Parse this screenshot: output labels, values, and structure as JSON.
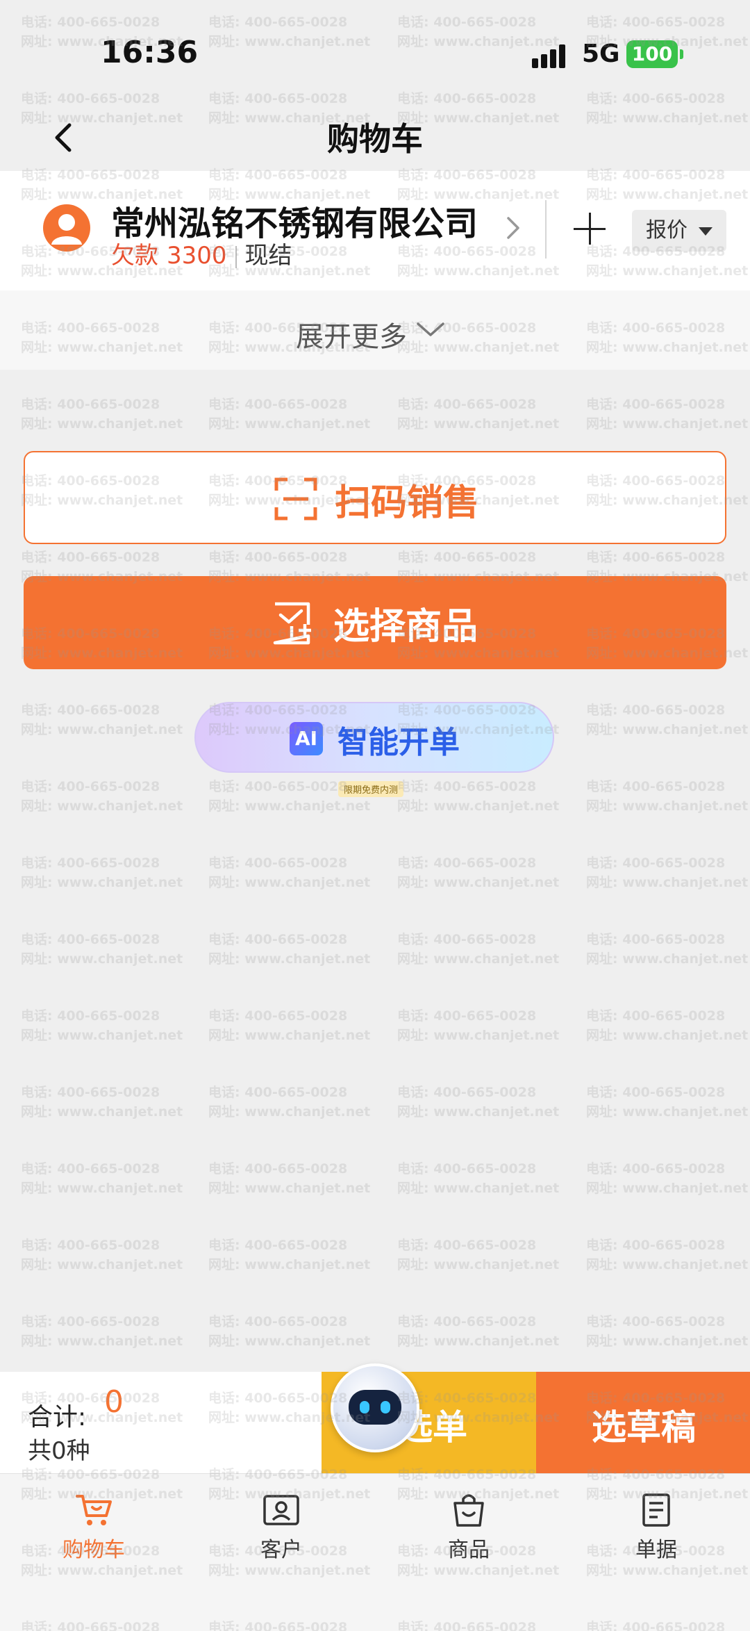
{
  "status_bar": {
    "time": "16:36",
    "network": "5G",
    "battery": "100"
  },
  "nav": {
    "title": "购物车"
  },
  "customer": {
    "name": "常州泓铭不锈钢有限公司",
    "debt_label": "欠款",
    "debt_value": "3300",
    "settle_label": "现结",
    "quote_label": "报价"
  },
  "expand": {
    "label": "展开更多"
  },
  "actions": {
    "scan_label": "扫码销售",
    "select_label": "选择商品",
    "ai_badge": "AI",
    "ai_label": "智能开单",
    "ai_tag": "限期免费内测"
  },
  "summary": {
    "total_label": "合计:",
    "total_value": "0",
    "kind_count": "共0种",
    "order_label": "选单",
    "draft_label": "选草稿"
  },
  "tabs": [
    {
      "label": "购物车",
      "icon": "cart-icon",
      "active": true
    },
    {
      "label": "客户",
      "icon": "customer-card-icon",
      "active": false
    },
    {
      "label": "商品",
      "icon": "shopping-bag-icon",
      "active": false
    },
    {
      "label": "单据",
      "icon": "document-icon",
      "active": false
    }
  ],
  "watermark": {
    "phone": "电话: 400-665-0028",
    "site": "网址: www.chanjet.net"
  },
  "colors": {
    "accent": "#f47232",
    "debt": "#e9502f",
    "order": "#f4b825",
    "ai": "#2b5fe8"
  }
}
